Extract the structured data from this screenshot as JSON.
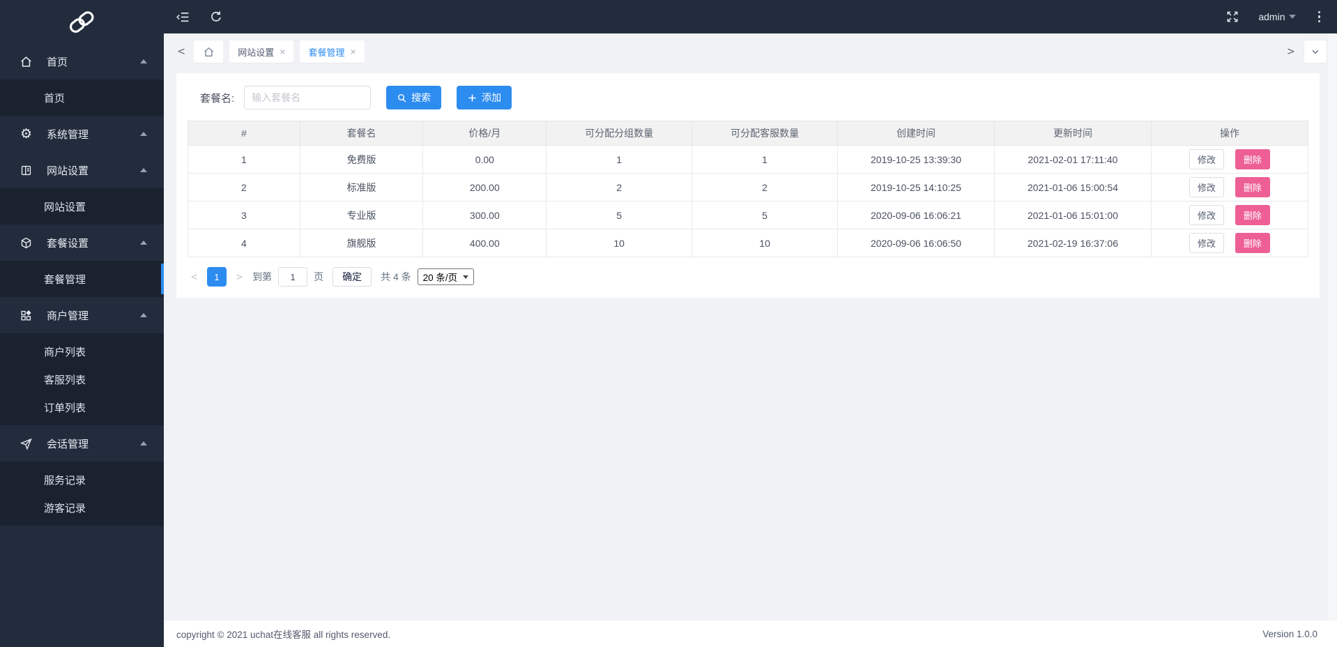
{
  "colors": {
    "accent": "#2d8cf0",
    "danger": "#ed5f95",
    "sidebar_bg": "#222c3c",
    "sidebar_sub_bg": "#1a2230",
    "content_bg": "#f0f2f5"
  },
  "sidebar": {
    "menu": {
      "home_group": "首页",
      "home_sub": "首页",
      "system_group": "系统管理",
      "site_group": "网站设置",
      "site_sub": "网站设置",
      "package_group": "套餐设置",
      "package_sub": "套餐管理",
      "merchant_group": "商户管理",
      "merchant_sub_1": "商户列表",
      "merchant_sub_2": "客服列表",
      "merchant_sub_3": "订单列表",
      "session_group": "会话管理",
      "session_sub_1": "服务记录",
      "session_sub_2": "游客记录"
    }
  },
  "topbar": {
    "user": "admin"
  },
  "tabbar": {
    "tab_site": "网站设置",
    "tab_package": "套餐管理"
  },
  "toolbar": {
    "search_label": "套餐名:",
    "search_placeholder": "输入套餐名",
    "search_button": "搜索",
    "add_button": "添加"
  },
  "table": {
    "columns": [
      "#",
      "套餐名",
      "价格/月",
      "可分配分组数量",
      "可分配客服数量",
      "创建时间",
      "更新时间",
      "操作"
    ],
    "rows": [
      {
        "id": "1",
        "name": "免费版",
        "price": "0.00",
        "groups": "1",
        "agents": "1",
        "created": "2019-10-25 13:39:30",
        "updated": "2021-02-01 17:11:40"
      },
      {
        "id": "2",
        "name": "标准版",
        "price": "200.00",
        "groups": "2",
        "agents": "2",
        "created": "2019-10-25 14:10:25",
        "updated": "2021-01-06 15:00:54"
      },
      {
        "id": "3",
        "name": "专业版",
        "price": "300.00",
        "groups": "5",
        "agents": "5",
        "created": "2020-09-06 16:06:21",
        "updated": "2021-01-06 15:01:00"
      },
      {
        "id": "4",
        "name": "旗舰版",
        "price": "400.00",
        "groups": "10",
        "agents": "10",
        "created": "2020-09-06 16:06:50",
        "updated": "2021-02-19 16:37:06"
      }
    ],
    "edit_label": "修改",
    "delete_label": "删除"
  },
  "pagination": {
    "prev": "<",
    "current_page": "1",
    "next": ">",
    "goto_label": "到第",
    "goto_value": "1",
    "page_label": "页",
    "confirm_label": "确定",
    "total_label": "共 4 条",
    "page_size_label": "20 条/页"
  },
  "icons": {
    "gear": "⚙",
    "close": "×",
    "back_chevron": "<",
    "forward_chevron": ">"
  },
  "footer": {
    "copyright": "copyright © 2021 uchat在线客服 all rights reserved.",
    "version": "Version 1.0.0"
  }
}
